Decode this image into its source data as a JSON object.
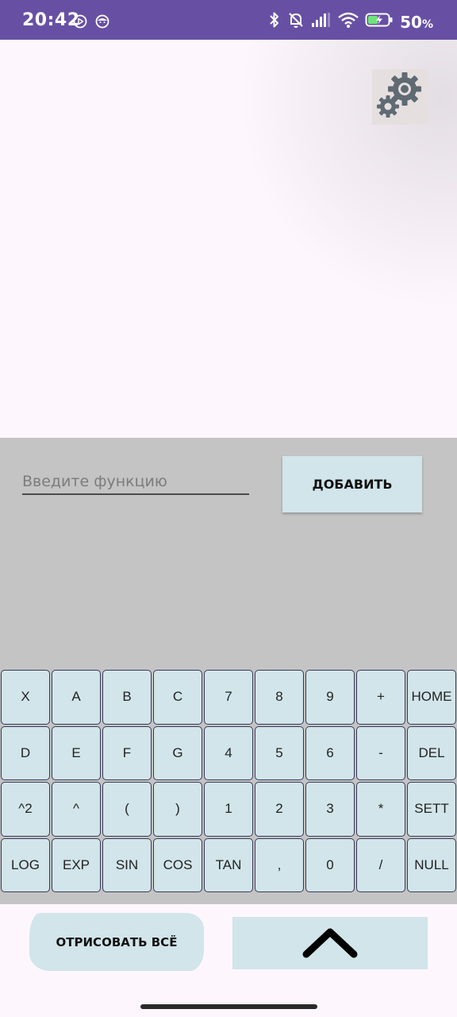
{
  "status_bar": {
    "time": "20:42",
    "battery_percent": "50",
    "battery_unit": "%",
    "icons": [
      "play-store-icon",
      "face-icon",
      "bluetooth-icon",
      "mute-icon",
      "signal-icon",
      "wifi-icon",
      "battery-charging-icon"
    ]
  },
  "graph": {
    "settings_icon": "gears-icon"
  },
  "input_panel": {
    "function_placeholder": "Введите функцию",
    "function_value": "",
    "add_label": "ДОБАВИТЬ"
  },
  "keyboard": {
    "keys": [
      "X",
      "A",
      "B",
      "C",
      "7",
      "8",
      "9",
      "+",
      "HOME",
      "D",
      "E",
      "F",
      "G",
      "4",
      "5",
      "6",
      "-",
      "DEL",
      "^2",
      "^",
      "(",
      ")",
      "1",
      "2",
      "3",
      "*",
      "SETT",
      "LOG",
      "EXP",
      "SIN",
      "COS",
      "TAN",
      ",",
      "0",
      "/",
      "NULL"
    ]
  },
  "bottom_bar": {
    "draw_all_label": "ОТРИСОВАТЬ ВСЁ",
    "up_icon": "chevron-up-icon"
  },
  "colors": {
    "status_bar": "#6750a4",
    "panel_gray": "#c4c4c4",
    "key_background": "#d1e5ea",
    "page_background": "#fdf7fd"
  }
}
